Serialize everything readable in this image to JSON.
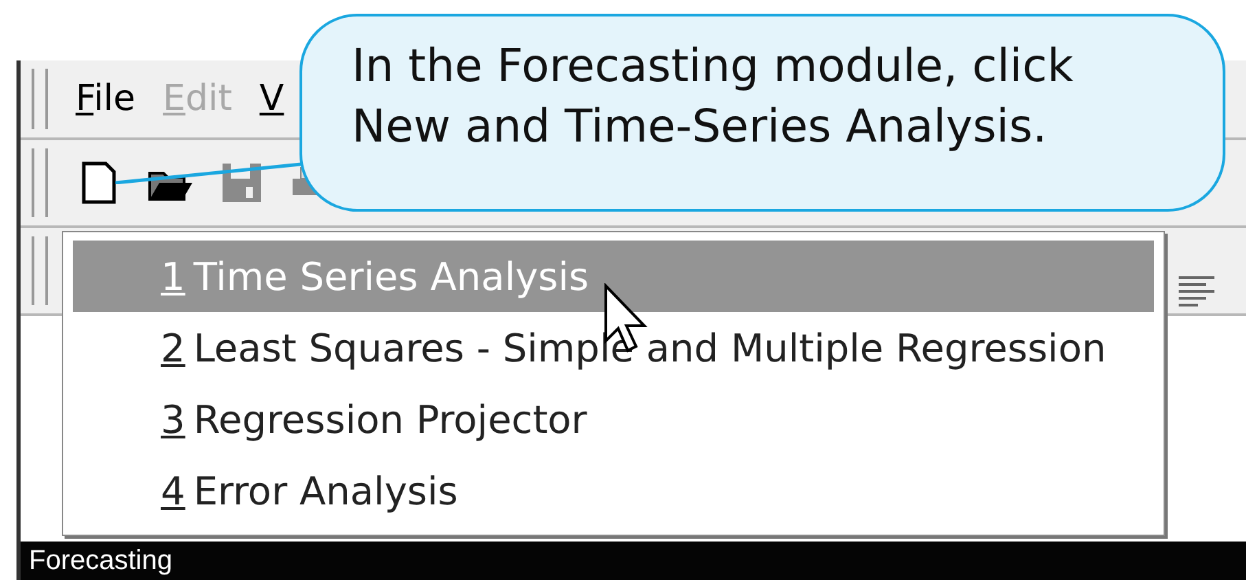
{
  "callout": {
    "text": "In the Forecasting module, click New and Time-Series Analysis."
  },
  "menu_bar": [
    {
      "mnemonic": "F",
      "label": "ile",
      "disabled": false
    },
    {
      "mnemonic": "E",
      "label": "dit",
      "disabled": true
    },
    {
      "mnemonic": "V",
      "disabled": false
    }
  ],
  "toolbar": [
    {
      "kind": "new",
      "disabled": false
    },
    {
      "kind": "open",
      "disabled": false
    },
    {
      "kind": "save",
      "disabled": true
    },
    {
      "kind": "print",
      "disabled": true
    }
  ],
  "dropdown": [
    {
      "number": "1",
      "label": "Time Series Analysis",
      "selected": true
    },
    {
      "number": "2",
      "label": "Least Squares - Simple and Multiple Regression",
      "selected": false
    },
    {
      "number": "3",
      "label": "Regression Projector",
      "selected": false
    },
    {
      "number": "4",
      "label": "Error Analysis",
      "selected": false
    }
  ],
  "status_bar": {
    "text": "Forecasting"
  }
}
